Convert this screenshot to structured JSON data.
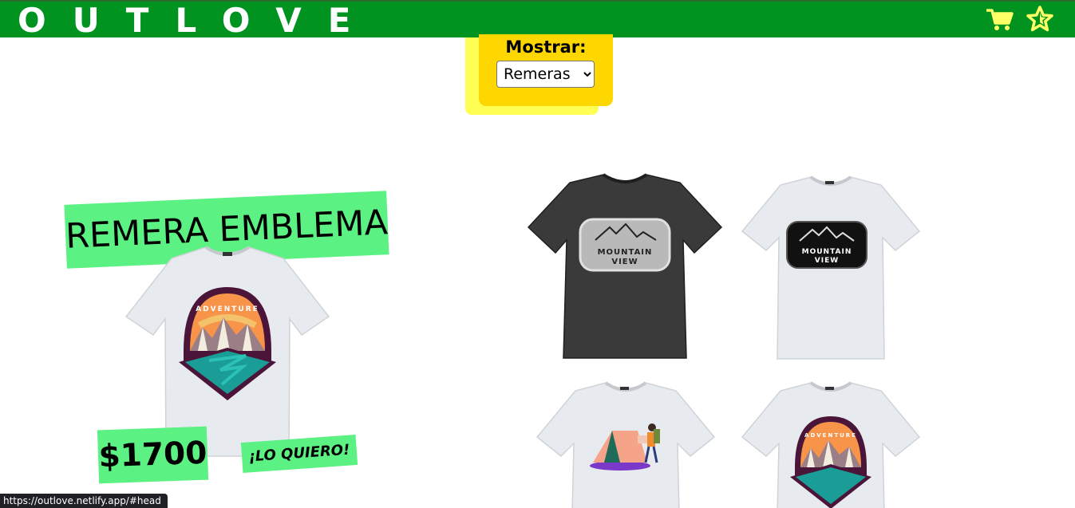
{
  "header": {
    "logo": "OUTLOVE",
    "icons": [
      "cart-icon",
      "star-icon"
    ],
    "color": "#00931f",
    "icon_color": "#ffff66"
  },
  "filter": {
    "label": "Mostrar:",
    "selected": "Remeras",
    "color": "#ffd700"
  },
  "featured": {
    "title": "REMERA EMBLEMA",
    "price": "$1700",
    "cta": "¡LO QUIERO!",
    "accent": "#5cf283"
  },
  "grid": {
    "items": [
      {
        "logo_line1": "MOUNTAIN",
        "logo_line2": "VIEW",
        "shirt_color": "#3a3a3a"
      },
      {
        "logo_line1": "MOUNTAIN",
        "logo_line2": "VIEW",
        "shirt_color": "#e9ecef"
      },
      {
        "design": "tent-hiker",
        "shirt_color": "#e9ecef"
      },
      {
        "design": "adventure-emblem",
        "shirt_color": "#e9ecef"
      }
    ]
  },
  "emblem_text": "ADVENTURE",
  "status_url": "https://outlove.netlify.app/#head"
}
